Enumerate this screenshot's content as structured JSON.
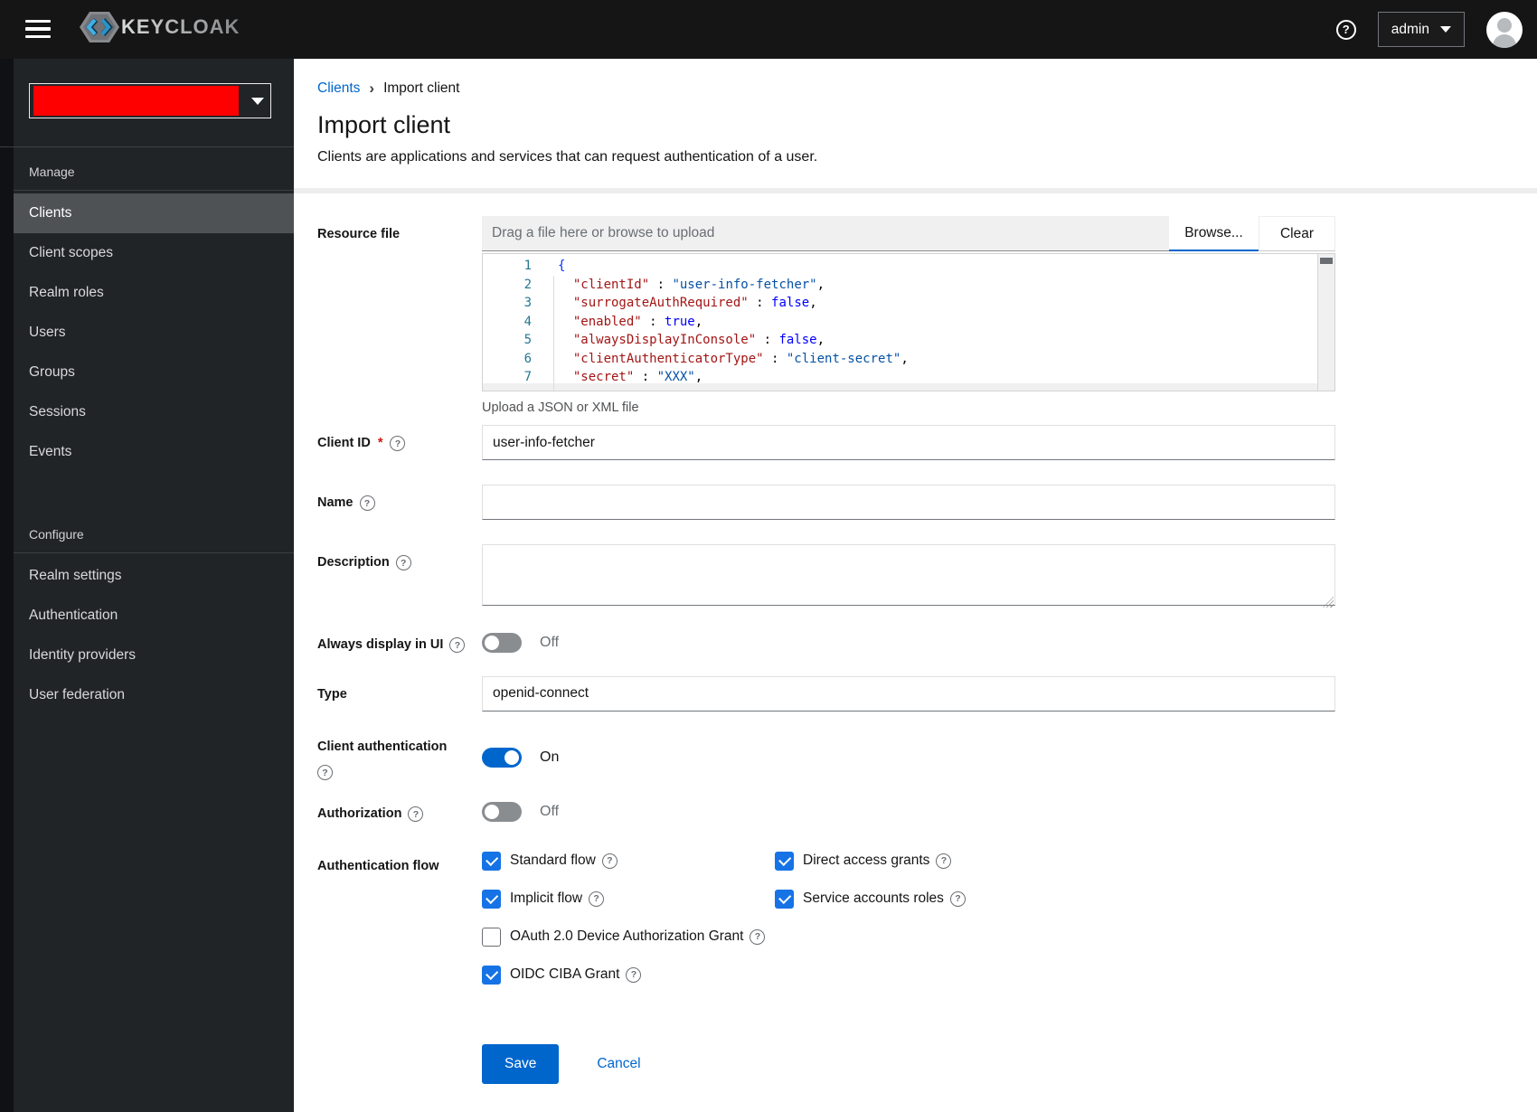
{
  "topbar": {
    "brand": "KEYCLOAK",
    "user_menu": "admin"
  },
  "sidebar": {
    "sections": [
      {
        "title": "Manage",
        "items": [
          {
            "label": "Clients",
            "selected": true
          },
          {
            "label": "Client scopes",
            "selected": false
          },
          {
            "label": "Realm roles",
            "selected": false
          },
          {
            "label": "Users",
            "selected": false
          },
          {
            "label": "Groups",
            "selected": false
          },
          {
            "label": "Sessions",
            "selected": false
          },
          {
            "label": "Events",
            "selected": false
          }
        ]
      },
      {
        "title": "Configure",
        "items": [
          {
            "label": "Realm settings",
            "selected": false
          },
          {
            "label": "Authentication",
            "selected": false
          },
          {
            "label": "Identity providers",
            "selected": false
          },
          {
            "label": "User federation",
            "selected": false
          }
        ]
      }
    ]
  },
  "breadcrumb": {
    "parent": "Clients",
    "current": "Import client"
  },
  "page": {
    "title": "Import client",
    "subtitle": "Clients are applications and services that can request authentication of a user."
  },
  "form": {
    "resource_file": {
      "label": "Resource file",
      "placeholder": "Drag a file here or browse to upload",
      "browse": "Browse...",
      "clear": "Clear",
      "hint": "Upload a JSON or XML file"
    },
    "client_id": {
      "label": "Client ID",
      "required": "*",
      "value": "user-info-fetcher"
    },
    "name": {
      "label": "Name",
      "value": ""
    },
    "description": {
      "label": "Description",
      "value": ""
    },
    "always_display": {
      "label": "Always display in UI",
      "state": "Off",
      "on": false
    },
    "type": {
      "label": "Type",
      "value": "openid-connect"
    },
    "client_auth": {
      "label": "Client authentication",
      "state": "On",
      "on": true
    },
    "authorization": {
      "label": "Authorization",
      "state": "Off",
      "on": false
    },
    "auth_flow": {
      "label": "Authentication flow",
      "options": [
        {
          "label": "Standard flow",
          "checked": true
        },
        {
          "label": "Direct access grants",
          "checked": true
        },
        {
          "label": "Implicit flow",
          "checked": true
        },
        {
          "label": "Service accounts roles",
          "checked": true
        },
        {
          "label": "OAuth 2.0 Device Authorization Grant",
          "checked": false
        },
        {
          "label": "OIDC CIBA Grant",
          "checked": true
        }
      ]
    },
    "actions": {
      "save": "Save",
      "cancel": "Cancel"
    }
  },
  "editor": {
    "lines": [
      {
        "num": "1",
        "tokens": [
          {
            "t": "{",
            "c": "brace"
          }
        ]
      },
      {
        "num": "2",
        "tokens": [
          {
            "t": "  ",
            "c": "plain"
          },
          {
            "t": "\"clientId\"",
            "c": "key"
          },
          {
            "t": " : ",
            "c": "plain"
          },
          {
            "t": "\"user-info-fetcher\"",
            "c": "str"
          },
          {
            "t": ",",
            "c": "plain"
          }
        ]
      },
      {
        "num": "3",
        "tokens": [
          {
            "t": "  ",
            "c": "plain"
          },
          {
            "t": "\"surrogateAuthRequired\"",
            "c": "key"
          },
          {
            "t": " : ",
            "c": "plain"
          },
          {
            "t": "false",
            "c": "bool"
          },
          {
            "t": ",",
            "c": "plain"
          }
        ]
      },
      {
        "num": "4",
        "tokens": [
          {
            "t": "  ",
            "c": "plain"
          },
          {
            "t": "\"enabled\"",
            "c": "key"
          },
          {
            "t": " : ",
            "c": "plain"
          },
          {
            "t": "true",
            "c": "bool"
          },
          {
            "t": ",",
            "c": "plain"
          }
        ]
      },
      {
        "num": "5",
        "tokens": [
          {
            "t": "  ",
            "c": "plain"
          },
          {
            "t": "\"alwaysDisplayInConsole\"",
            "c": "key"
          },
          {
            "t": " : ",
            "c": "plain"
          },
          {
            "t": "false",
            "c": "bool"
          },
          {
            "t": ",",
            "c": "plain"
          }
        ]
      },
      {
        "num": "6",
        "tokens": [
          {
            "t": "  ",
            "c": "plain"
          },
          {
            "t": "\"clientAuthenticatorType\"",
            "c": "key"
          },
          {
            "t": " : ",
            "c": "plain"
          },
          {
            "t": "\"client-secret\"",
            "c": "str"
          },
          {
            "t": ",",
            "c": "plain"
          }
        ]
      },
      {
        "num": "7",
        "tokens": [
          {
            "t": "  ",
            "c": "plain"
          },
          {
            "t": "\"secret\"",
            "c": "key"
          },
          {
            "t": " : ",
            "c": "plain"
          },
          {
            "t": "\"XXX\"",
            "c": "str"
          },
          {
            "t": ",",
            "c": "plain"
          }
        ]
      }
    ]
  },
  "colors": {
    "accent": "#0066cc",
    "checkbox_blue": "#1673e6",
    "nav_selected_bar": "#73bcf7",
    "redacted_realm": "#ff0000",
    "required_red": "#c9190b",
    "topbar_bg": "#151515",
    "sidebar_bg": "#212427"
  }
}
